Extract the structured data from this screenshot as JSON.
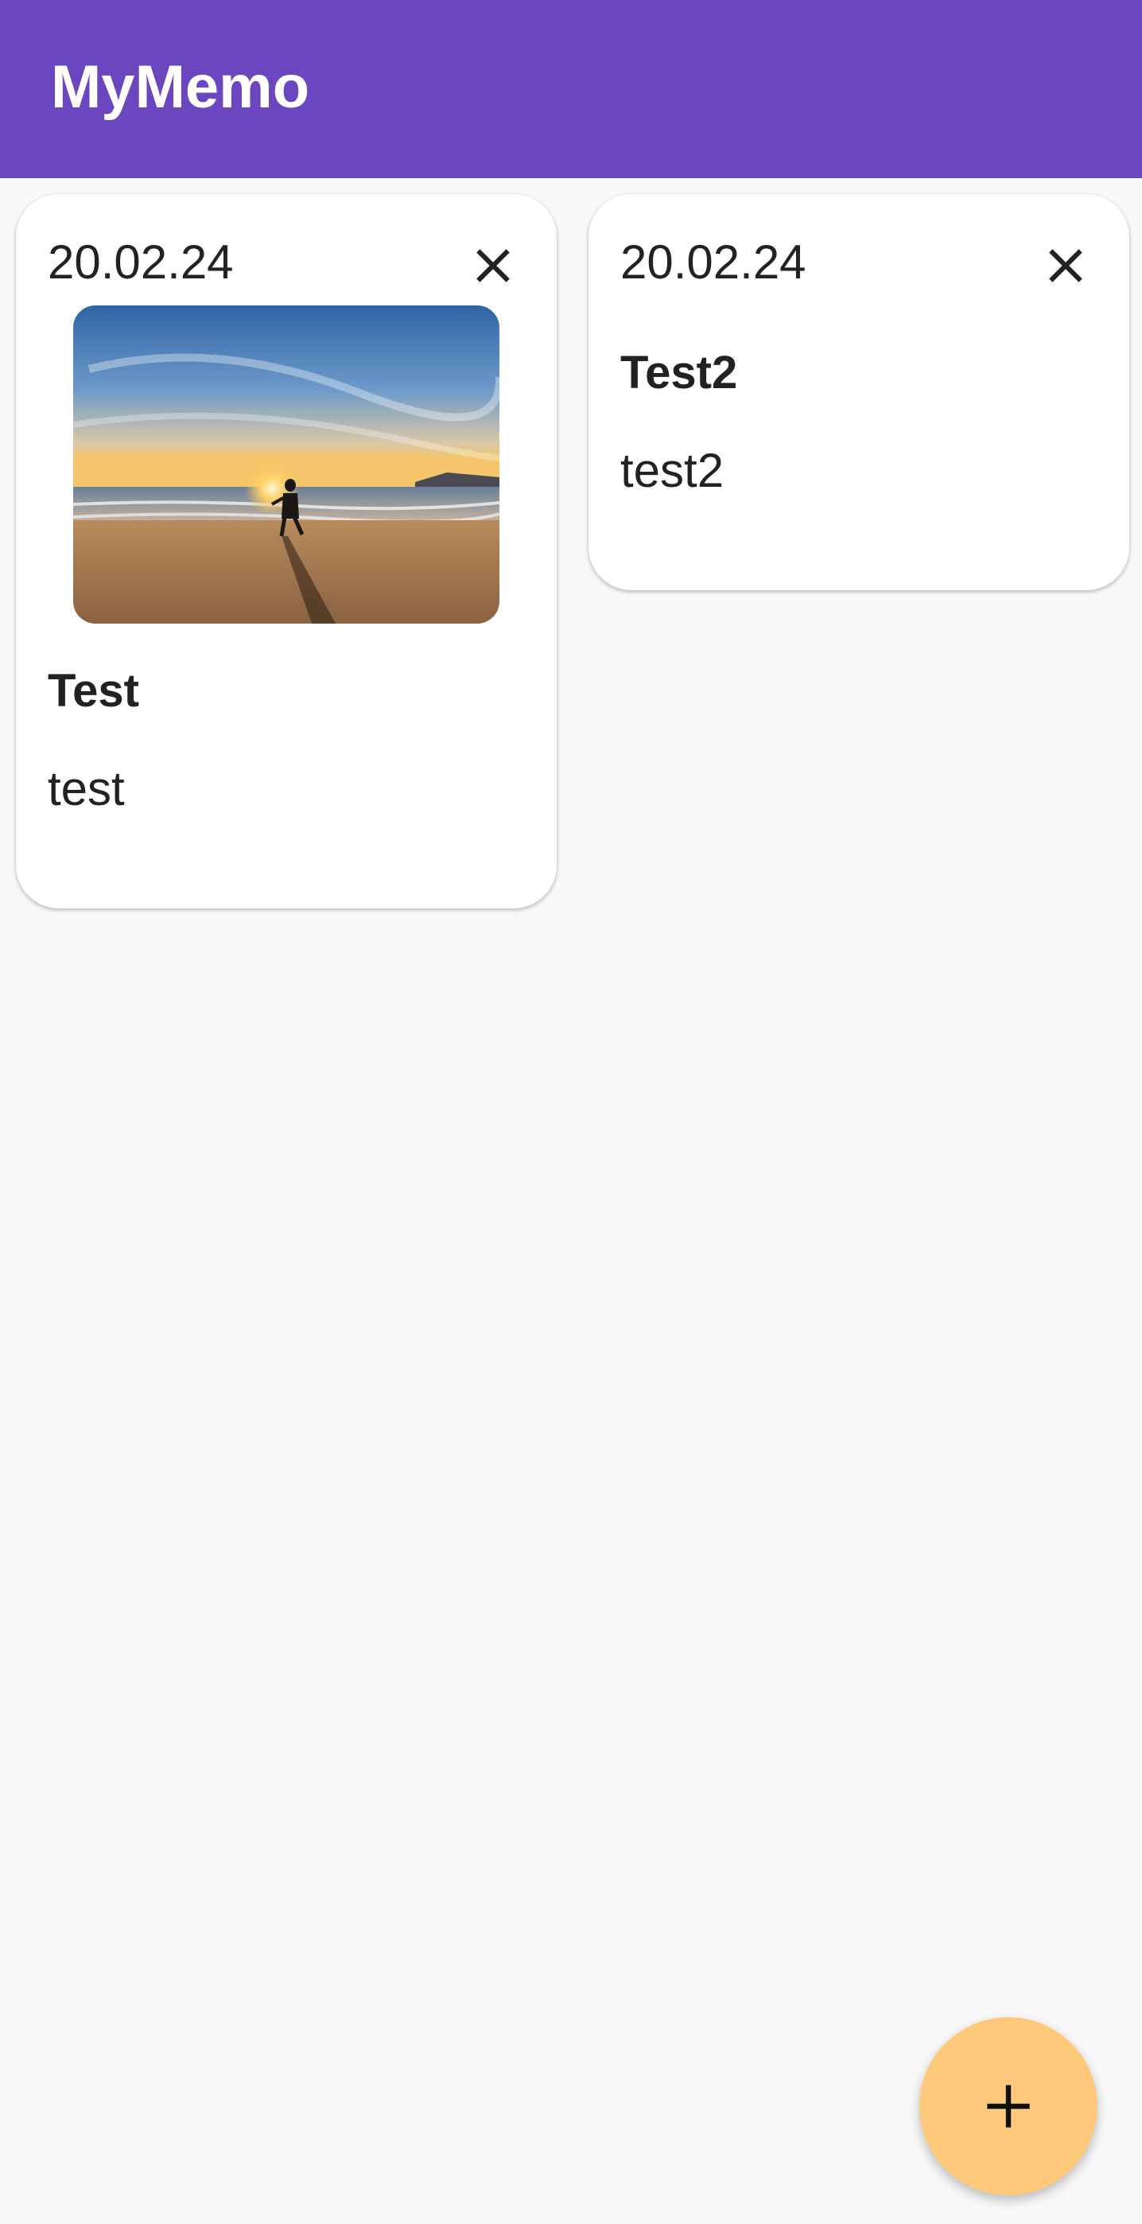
{
  "app_bar": {
    "title": "MyMemo",
    "color": "#6c46be"
  },
  "notes": [
    {
      "date": "20.02.24",
      "title": "Test",
      "body": "test",
      "has_image": true,
      "image_description_icon": "beach-sunset-photo",
      "delete_icon": "close-icon"
    },
    {
      "date": "20.02.24",
      "title": "Test2",
      "body": "test2",
      "has_image": false,
      "delete_icon": "close-icon"
    }
  ],
  "fab": {
    "icon": "plus-icon",
    "color": "#fec97a"
  },
  "colors": {
    "background": "#f9f9f9",
    "card": "#ffffff",
    "text": "#222222"
  }
}
